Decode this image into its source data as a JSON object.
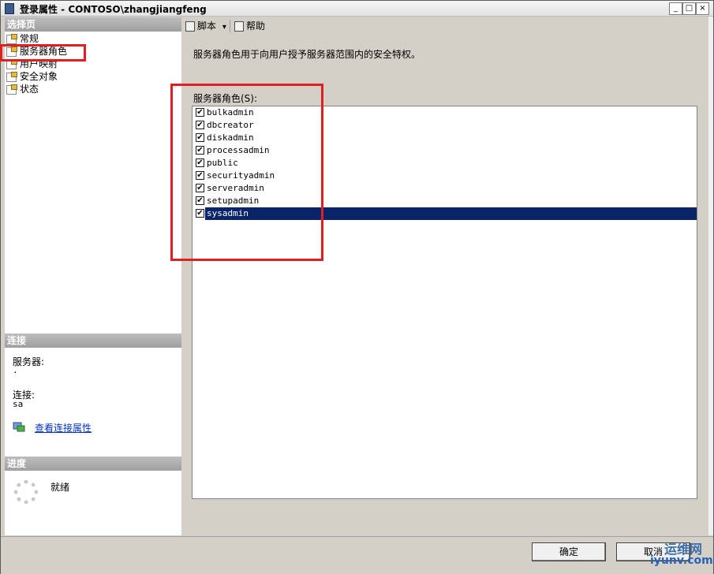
{
  "window": {
    "title": "登录属性 - CONTOSO\\zhangjiangfeng",
    "min": "_",
    "max": "□",
    "close": "×"
  },
  "left": {
    "select_header": "选择页",
    "nav": [
      {
        "label": "常规"
      },
      {
        "label": "服务器角色"
      },
      {
        "label": "用户映射"
      },
      {
        "label": "安全对象"
      },
      {
        "label": "状态"
      }
    ],
    "connection_header": "连接",
    "server_label": "服务器:",
    "server_value": ".",
    "conn_label": "连接:",
    "conn_value": "sa",
    "view_link": "查看连接属性",
    "progress_header": "进度",
    "progress_status": "就绪"
  },
  "toolbar": {
    "script": "脚本",
    "script_arrow": "▾",
    "help": "帮助"
  },
  "main": {
    "description": "服务器角色用于向用户授予服务器范围内的安全特权。",
    "roles_label": "服务器角色(S):",
    "roles": [
      {
        "name": "bulkadmin",
        "checked": true
      },
      {
        "name": "dbcreator",
        "checked": true
      },
      {
        "name": "diskadmin",
        "checked": true
      },
      {
        "name": "processadmin",
        "checked": true
      },
      {
        "name": "public",
        "checked": true
      },
      {
        "name": "securityadmin",
        "checked": true
      },
      {
        "name": "serveradmin",
        "checked": true
      },
      {
        "name": "setupadmin",
        "checked": true
      },
      {
        "name": "sysadmin",
        "checked": true,
        "selected": true
      }
    ],
    "check_mark": "✔"
  },
  "buttons": {
    "ok": "确定",
    "cancel": "取消"
  },
  "watermark": {
    "line1": "运维网",
    "line2": "iyunv.com"
  }
}
